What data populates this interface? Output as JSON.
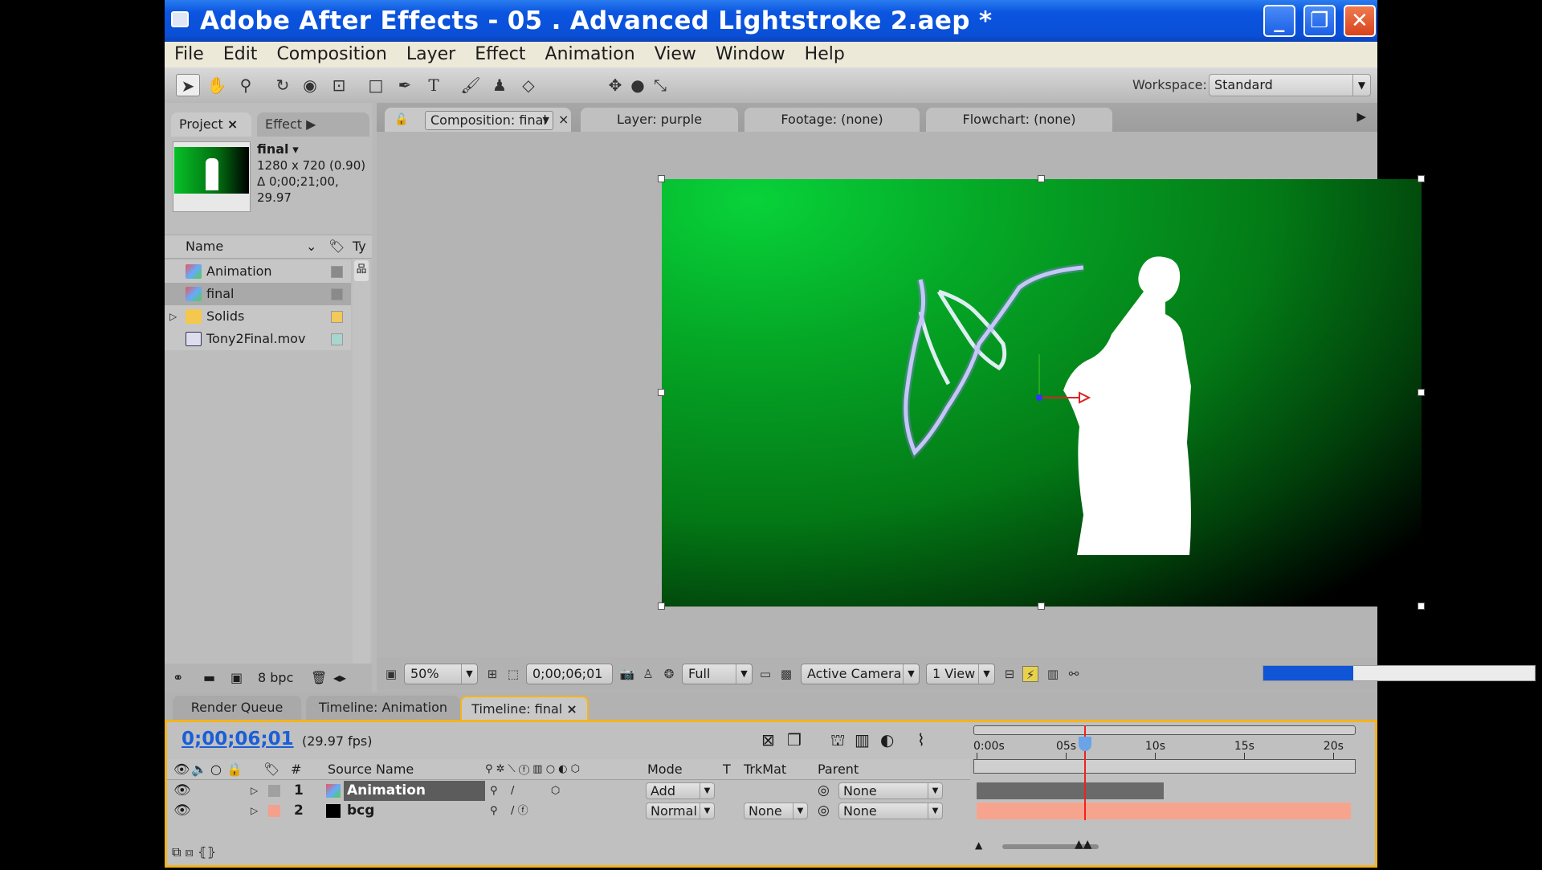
{
  "window": {
    "title": "Adobe After Effects - 05 .  Advanced Lightstroke 2.aep *",
    "controls": [
      "minimize",
      "restore",
      "close"
    ]
  },
  "menu": [
    "File",
    "Edit",
    "Composition",
    "Layer",
    "Effect",
    "Animation",
    "View",
    "Window",
    "Help"
  ],
  "toolbar": {
    "tools": [
      "selection-tool",
      "hand-tool",
      "zoom-tool",
      "rotation-tool",
      "orbit-camera-tool",
      "pan-behind-tool",
      "rectangle-mask-tool",
      "pen-tool",
      "type-tool",
      "brush-tool",
      "clone-stamp-tool",
      "eraser-tool"
    ],
    "axis_tools": [
      "local-axis",
      "world-axis",
      "view-axis"
    ],
    "workspace_label": "Workspace:",
    "workspace_value": "Standard"
  },
  "project": {
    "tabs": [
      "Project",
      "Effect"
    ],
    "selected": {
      "name": "final",
      "size": "1280 x 720 (0.90)",
      "duration": "Δ 0;00;21;00, 29.97"
    },
    "columns": [
      "Name",
      "Ty"
    ],
    "items": [
      {
        "name": "Animation",
        "type": "composition",
        "label_color": "#8a8a8a"
      },
      {
        "name": "final",
        "type": "composition",
        "label_color": "#8a8a8a"
      },
      {
        "name": "Solids",
        "type": "folder",
        "label_color": "#f2c95a"
      },
      {
        "name": "Tony2Final.mov",
        "type": "footage",
        "label_color": "#a9d6cc"
      }
    ],
    "bit_depth": "8 bpc"
  },
  "viewer": {
    "tabs": [
      "Composition: final",
      "Layer: purple",
      "Footage: (none)",
      "Flowchart: (none)"
    ],
    "zoom": "50%",
    "timecode": "0;00;06;01",
    "resolution": "Full",
    "camera": "Active Camera",
    "views": "1 View",
    "render_progress": 0.33
  },
  "timeline": {
    "tabs": [
      "Render Queue",
      "Timeline: Animation",
      "Timeline: final"
    ],
    "timecode": "0;00;06;01",
    "fps": "(29.97 fps)",
    "columns": [
      "#",
      "Source Name",
      "Mode",
      "T",
      "TrkMat",
      "Parent"
    ],
    "layers": [
      {
        "index": "1",
        "name": "Animation",
        "mode": "Add",
        "trkmat": "",
        "parent": "None",
        "label_color": "#a0a0a0",
        "bar_color": "#6a6a6a",
        "bar_end_s": 10.5,
        "selected": true
      },
      {
        "index": "2",
        "name": "bcg",
        "mode": "Normal",
        "trkmat": "None",
        "parent": "None",
        "label_color": "#f4a08c",
        "bar_color": "#f7a48e",
        "bar_end_s": 21,
        "selected": false
      }
    ],
    "ruler": {
      "labels": [
        "0:00s",
        "05s",
        "10s",
        "15s",
        "20s"
      ],
      "duration_s": 21,
      "current_s": 6.03
    }
  }
}
